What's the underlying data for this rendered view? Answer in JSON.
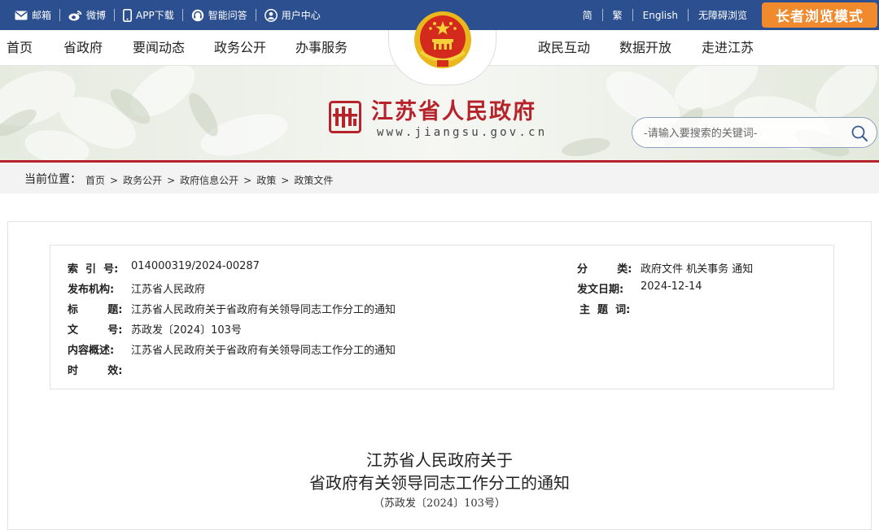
{
  "topbar": {
    "mail": "邮箱",
    "weibo": "微博",
    "app": "APP下载",
    "qa": "智能问答",
    "user": "用户中心",
    "simplified": "简",
    "traditional": "繁",
    "english": "English",
    "accessible": "无障碍浏览",
    "elder_mode": "长者浏览模式"
  },
  "nav": {
    "items": [
      "首页",
      "省政府",
      "要闻动态",
      "政务公开",
      "办事服务",
      "政民互动",
      "数据开放",
      "走进江苏"
    ]
  },
  "banner": {
    "site_title": "江苏省人民政府",
    "site_url": "www.jiangsu.gov.cn",
    "search_placeholder": "-请输入要搜索的关键词-"
  },
  "breadcrumb": {
    "label": "当前位置：",
    "items": [
      "首页",
      "政务公开",
      "政府信息公开",
      "政策",
      "政策文件"
    ],
    "separator": ">"
  },
  "meta": {
    "index_key": "索  引  号:",
    "index_val": "014000319/2024-00287",
    "category_key": "分        类:",
    "category_val": "政府文件 机关事务 通知",
    "publisher_key": "发布机构:",
    "publisher_val": "江苏省人民政府",
    "date_key": "发文日期:",
    "date_val": "2024-12-14",
    "title_key": "标        题:",
    "title_val": "江苏省人民政府关于省政府有关领导同志工作分工的通知",
    "topic_key": "主  题  词:",
    "topic_val": "",
    "docno_key": "文        号:",
    "docno_val": "苏政发〔2024〕103号",
    "summary_key": "内容概述:",
    "summary_val": "江苏省人民政府关于省政府有关领导同志工作分工的通知",
    "validity_key": "时        效:",
    "validity_val": ""
  },
  "document": {
    "title_line1": "江苏省人民政府关于",
    "title_line2": "省政府有关领导同志工作分工的通知",
    "doc_number": "（苏政发〔2024〕103号）"
  },
  "colors": {
    "topbar_bg": "#2b4f8f",
    "elder_btn": "#f1892d",
    "brand_red": "#b6232a"
  }
}
